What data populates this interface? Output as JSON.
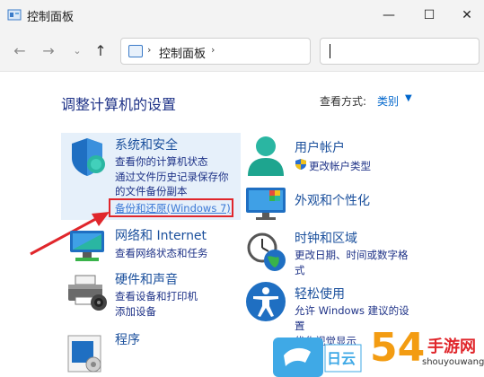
{
  "window": {
    "title": "控制面板",
    "min_glyph": "—",
    "max_glyph": "☐",
    "close_glyph": "✕"
  },
  "nav": {
    "back_glyph": "←",
    "forward_glyph": "→",
    "recent_glyph": "⌄",
    "up_glyph": "↑",
    "breadcrumb_sep": "›",
    "breadcrumb": "控制面板",
    "breadcrumb_trailing_sep": "›",
    "search_placeholder": ""
  },
  "main": {
    "heading": "调整计算机的设置",
    "view_by_label": "查看方式:",
    "view_by_value": "类别",
    "view_by_chevron": "▼"
  },
  "categories": {
    "system_security": {
      "title": "系统和安全",
      "links": [
        "查看你的计算机状态",
        "通过文件历史记录保存你",
        "的文件备份副本"
      ],
      "backup_link": "备份和还原(Windows 7)"
    },
    "network": {
      "title": "网络和 Internet",
      "links": [
        "查看网络状态和任务"
      ]
    },
    "hardware": {
      "title": "硬件和声音",
      "links": [
        "查看设备和打印机",
        "添加设备"
      ]
    },
    "programs": {
      "title": "程序"
    },
    "user_accounts": {
      "title": "用户帐户",
      "links": [
        "更改帐户类型"
      ]
    },
    "appearance": {
      "title": "外观和个性化"
    },
    "clock_region": {
      "title": "时钟和区域",
      "links": [
        "更改日期、时间或数字格",
        "式"
      ]
    },
    "ease_access": {
      "title": "轻松使用",
      "links": [
        "允许 Windows 建议的设",
        "置",
        "优化视觉显示"
      ]
    }
  },
  "watermark": {
    "text": "手游网",
    "url": "shouyouwang.cn",
    "number": "54"
  },
  "colors": {
    "link": "#1e3287",
    "title": "#1a4f9c",
    "highlight": "#e6f0fa",
    "annotation_red": "#e0262b"
  }
}
